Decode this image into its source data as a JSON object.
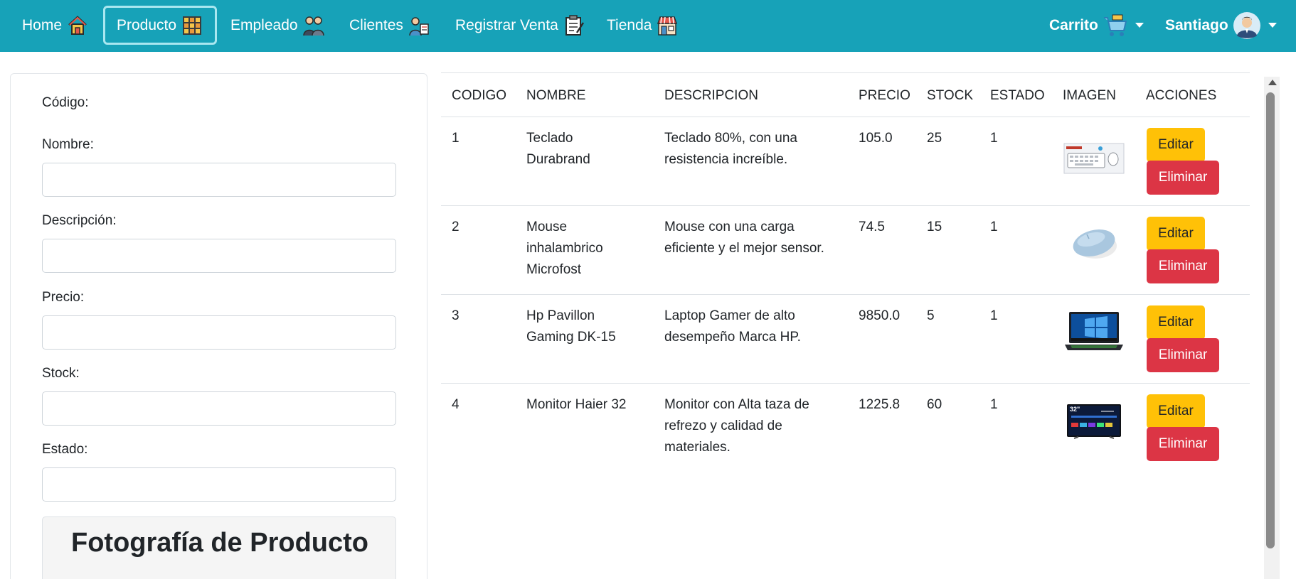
{
  "nav": {
    "items": [
      {
        "label": "Home",
        "icon": "house-icon"
      },
      {
        "label": "Producto",
        "icon": "products-shelf-icon",
        "active": true
      },
      {
        "label": "Empleado",
        "icon": "employees-icon"
      },
      {
        "label": "Clientes",
        "icon": "clients-icon"
      },
      {
        "label": "Registrar Venta",
        "icon": "clipboard-icon"
      },
      {
        "label": "Tienda",
        "icon": "store-icon"
      }
    ],
    "cart_label": "Carrito",
    "user_name": "Santiago"
  },
  "form": {
    "codigo_label": "Código:",
    "nombre_label": "Nombre:",
    "descripcion_label": "Descripción:",
    "precio_label": "Precio:",
    "stock_label": "Stock:",
    "estado_label": "Estado:",
    "nombre_value": "",
    "descripcion_value": "",
    "precio_value": "",
    "stock_value": "",
    "estado_value": "",
    "photo_title": "Fotografía de Producto"
  },
  "table": {
    "headers": [
      "CODIGO",
      "NOMBRE",
      "DESCRIPCION",
      "PRECIO",
      "STOCK",
      "ESTADO",
      "IMAGEN",
      "ACCIONES"
    ],
    "edit_label": "Editar",
    "delete_label": "Eliminar",
    "rows": [
      {
        "codigo": "1",
        "nombre_lines": [
          "Teclado",
          "Durabrand"
        ],
        "descripcion_lines": [
          "Teclado 80%, con una",
          "resistencia increíble."
        ],
        "precio": "105.0",
        "stock": "25",
        "estado": "1",
        "image": "keyboard-image"
      },
      {
        "codigo": "2",
        "nombre_lines": [
          "Mouse",
          "inhalambrico",
          "Microfost"
        ],
        "descripcion_lines": [
          "Mouse con una carga",
          "eficiente y el mejor sensor."
        ],
        "precio": "74.5",
        "stock": "15",
        "estado": "1",
        "image": "mouse-image"
      },
      {
        "codigo": "3",
        "nombre_lines": [
          "Hp Pavillon",
          "Gaming DK-15"
        ],
        "descripcion_lines": [
          "Laptop Gamer de alto",
          "desempeño Marca HP."
        ],
        "precio": "9850.0",
        "stock": "5",
        "estado": "1",
        "image": "laptop-image"
      },
      {
        "codigo": "4",
        "nombre_lines": [
          "Monitor Haier 32"
        ],
        "descripcion_lines": [
          "Monitor con Alta taza de",
          "refrezo y calidad de",
          "materiales."
        ],
        "precio": "1225.8",
        "stock": "60",
        "estado": "1",
        "image": "monitor-image",
        "monitor_badge": "32\""
      }
    ]
  },
  "colors": {
    "navbar": "#17a2b8",
    "edit_button": "#ffc107",
    "delete_button": "#dc3545"
  }
}
